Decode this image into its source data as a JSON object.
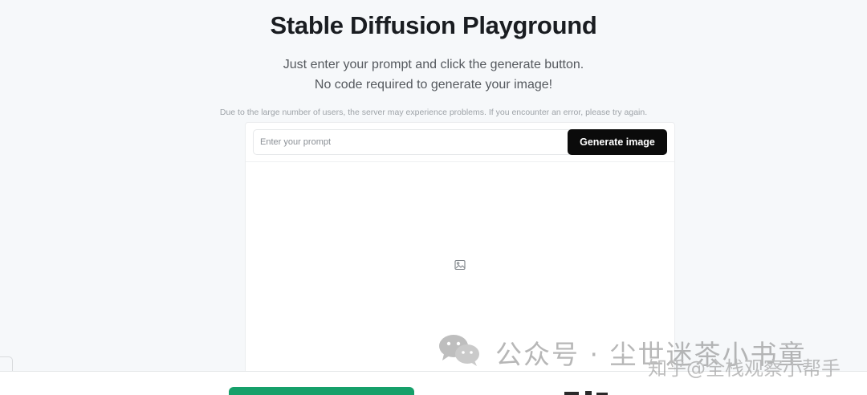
{
  "header": {
    "title": "Stable Diffusion Playground",
    "subtitle_line1": "Just enter your prompt and click the generate button.",
    "subtitle_line2": "No code required to generate your image!",
    "notice": "Due to the large number of users, the server may experience problems. If you encounter an error, please try again."
  },
  "prompt": {
    "value": "",
    "placeholder": "Enter your prompt",
    "button_label": "Generate image"
  },
  "output": {
    "placeholder_icon": "image-icon"
  },
  "watermark": {
    "logo_icon": "wechat-icon",
    "text": "公众号 · 尘世迷茶小书童",
    "text2": "知乎@全栈观察小帮手"
  },
  "colors": {
    "background": "#f6f8fa",
    "button_bg": "#0b0b0b",
    "green_button": "#16a06a"
  }
}
